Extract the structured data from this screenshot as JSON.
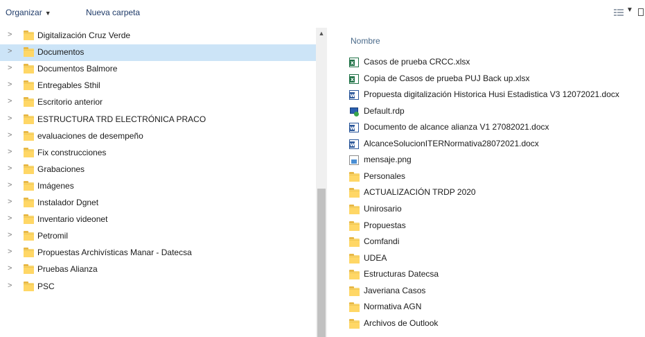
{
  "toolbar": {
    "organizar": "Organizar",
    "nueva_carpeta": "Nueva carpeta"
  },
  "tree": {
    "items": [
      {
        "label": "Digitalización Cruz Verde",
        "selected": false
      },
      {
        "label": "Documentos",
        "selected": true
      },
      {
        "label": "Documentos Balmore",
        "selected": false
      },
      {
        "label": "Entregables Sthil",
        "selected": false
      },
      {
        "label": "Escritorio anterior",
        "selected": false
      },
      {
        "label": "ESTRUCTURA TRD ELECTRÓNICA PRACO",
        "selected": false
      },
      {
        "label": "evaluaciones de desempeño",
        "selected": false
      },
      {
        "label": "Fix construcciones",
        "selected": false
      },
      {
        "label": "Grabaciones",
        "selected": false
      },
      {
        "label": "Imágenes",
        "selected": false
      },
      {
        "label": "Instalador Dgnet",
        "selected": false
      },
      {
        "label": "Inventario videonet",
        "selected": false
      },
      {
        "label": "Petromil",
        "selected": false
      },
      {
        "label": "Propuestas Archivísticas Manar - Datecsa",
        "selected": false
      },
      {
        "label": "Pruebas Alianza",
        "selected": false
      },
      {
        "label": "PSC",
        "selected": false
      }
    ]
  },
  "content": {
    "column_header": "Nombre",
    "files": [
      {
        "name": "Casos de prueba CRCC.xlsx",
        "icon": "excel-file-icon"
      },
      {
        "name": "Copia de Casos de prueba PUJ Back up.xlsx",
        "icon": "excel-file-icon"
      },
      {
        "name": "Propuesta digitalización Historica Husi Estadistica V3  12072021.docx",
        "icon": "word-file-icon"
      },
      {
        "name": "Default.rdp",
        "icon": "remote-desktop-file-icon"
      },
      {
        "name": "Documento de alcance alianza V1 27082021.docx",
        "icon": "word-file-icon"
      },
      {
        "name": "AlcanceSolucionITERNormativa28072021.docx",
        "icon": "word-file-icon"
      },
      {
        "name": "mensaje.png",
        "icon": "image-file-icon"
      },
      {
        "name": "Personales",
        "icon": "folder-icon"
      },
      {
        "name": "ACTUALIZACIÓN TRDP 2020",
        "icon": "folder-icon"
      },
      {
        "name": "Unirosario",
        "icon": "folder-icon"
      },
      {
        "name": "Propuestas",
        "icon": "folder-icon"
      },
      {
        "name": "Comfandi",
        "icon": "folder-icon"
      },
      {
        "name": "UDEA",
        "icon": "folder-icon"
      },
      {
        "name": "Estructuras Datecsa",
        "icon": "folder-icon"
      },
      {
        "name": "Javeriana Casos",
        "icon": "folder-icon"
      },
      {
        "name": "Normativa AGN",
        "icon": "folder-icon"
      },
      {
        "name": "Archivos de Outlook",
        "icon": "folder-icon"
      }
    ]
  },
  "colors": {
    "selection": "#cce4f7",
    "folder": "#ffd766",
    "toolbar_text": "#1e3a68"
  }
}
